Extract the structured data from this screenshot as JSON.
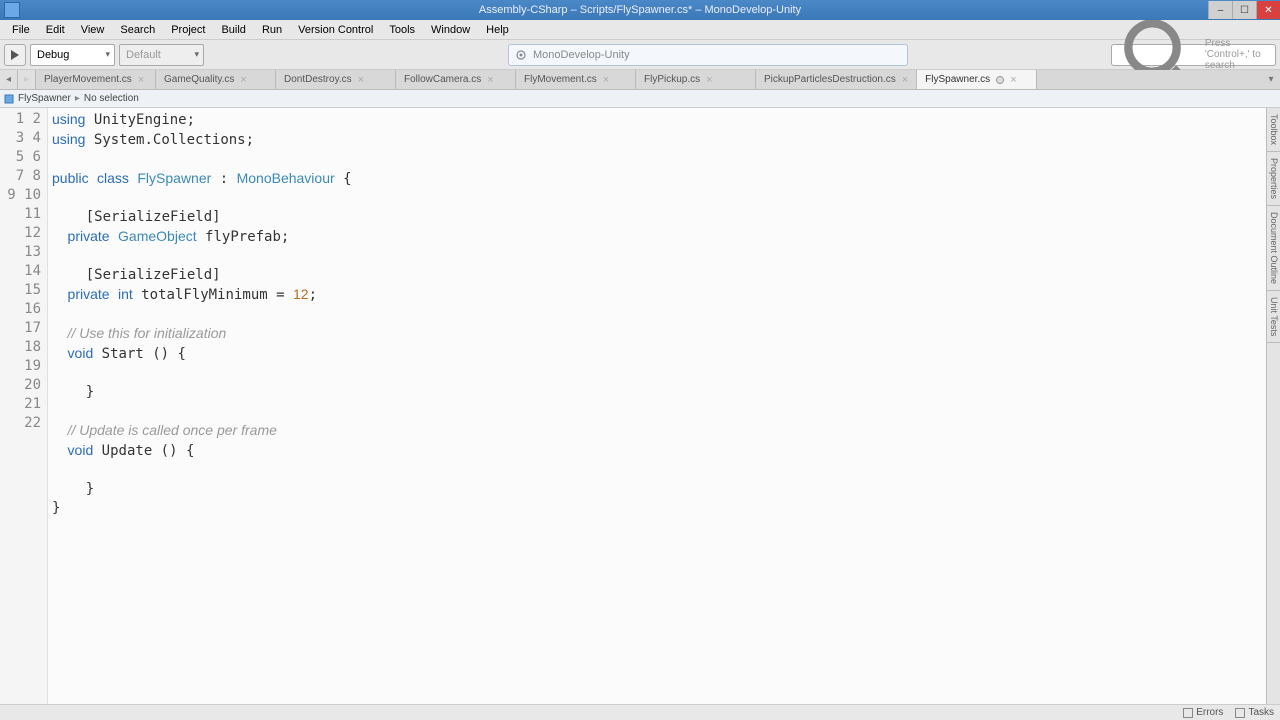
{
  "title": "Assembly-CSharp – Scripts/FlySpawner.cs* – MonoDevelop-Unity",
  "menu": [
    "File",
    "Edit",
    "View",
    "Search",
    "Project",
    "Build",
    "Run",
    "Version Control",
    "Tools",
    "Window",
    "Help"
  ],
  "toolbar": {
    "config": "Debug",
    "target": "Default",
    "center_text": "MonoDevelop-Unity",
    "search_placeholder": "Press 'Control+,' to search"
  },
  "tabs": [
    {
      "label": "PlayerMovement.cs",
      "active": false
    },
    {
      "label": "GameQuality.cs",
      "active": false
    },
    {
      "label": "DontDestroy.cs",
      "active": false
    },
    {
      "label": "FollowCamera.cs",
      "active": false
    },
    {
      "label": "FlyMovement.cs",
      "active": false
    },
    {
      "label": "FlyPickup.cs",
      "active": false
    },
    {
      "label": "PickupParticlesDestruction.cs",
      "active": false
    },
    {
      "label": "FlySpawner.cs",
      "active": true,
      "dirty": true
    }
  ],
  "breadcrumb": {
    "class": "FlySpawner",
    "member": "No selection"
  },
  "code": {
    "lines": 22,
    "l1a": "using",
    "l1b": " UnityEngine;",
    "l2a": "using",
    "l2b": " System.Collections;",
    "l4a": "public",
    "l4b": "class",
    "l4c": "FlySpawner",
    "l4d": " : ",
    "l4e": "MonoBehaviour",
    "l4f": " {",
    "l6": "    [SerializeField]",
    "l7a": "    private",
    "l7b": "GameObject",
    "l7c": " flyPrefab;",
    "l9": "    [SerializeField]",
    "l10a": "    private",
    "l10b": "int",
    "l10c": " totalFlyMinimum = ",
    "l10d": "12",
    "l10e": ";",
    "l12": "    // Use this for initialization",
    "l13a": "    void",
    "l13b": " Start () {",
    "l15": "    }",
    "l17": "    // Update is called once per frame",
    "l18a": "    void",
    "l18b": " Update () {",
    "l20": "    }",
    "l21": "}"
  },
  "side_panels": [
    "Toolbox",
    "Properties",
    "Document Outline",
    "Unit Tests"
  ],
  "status": {
    "errors": "Errors",
    "tasks": "Tasks"
  }
}
